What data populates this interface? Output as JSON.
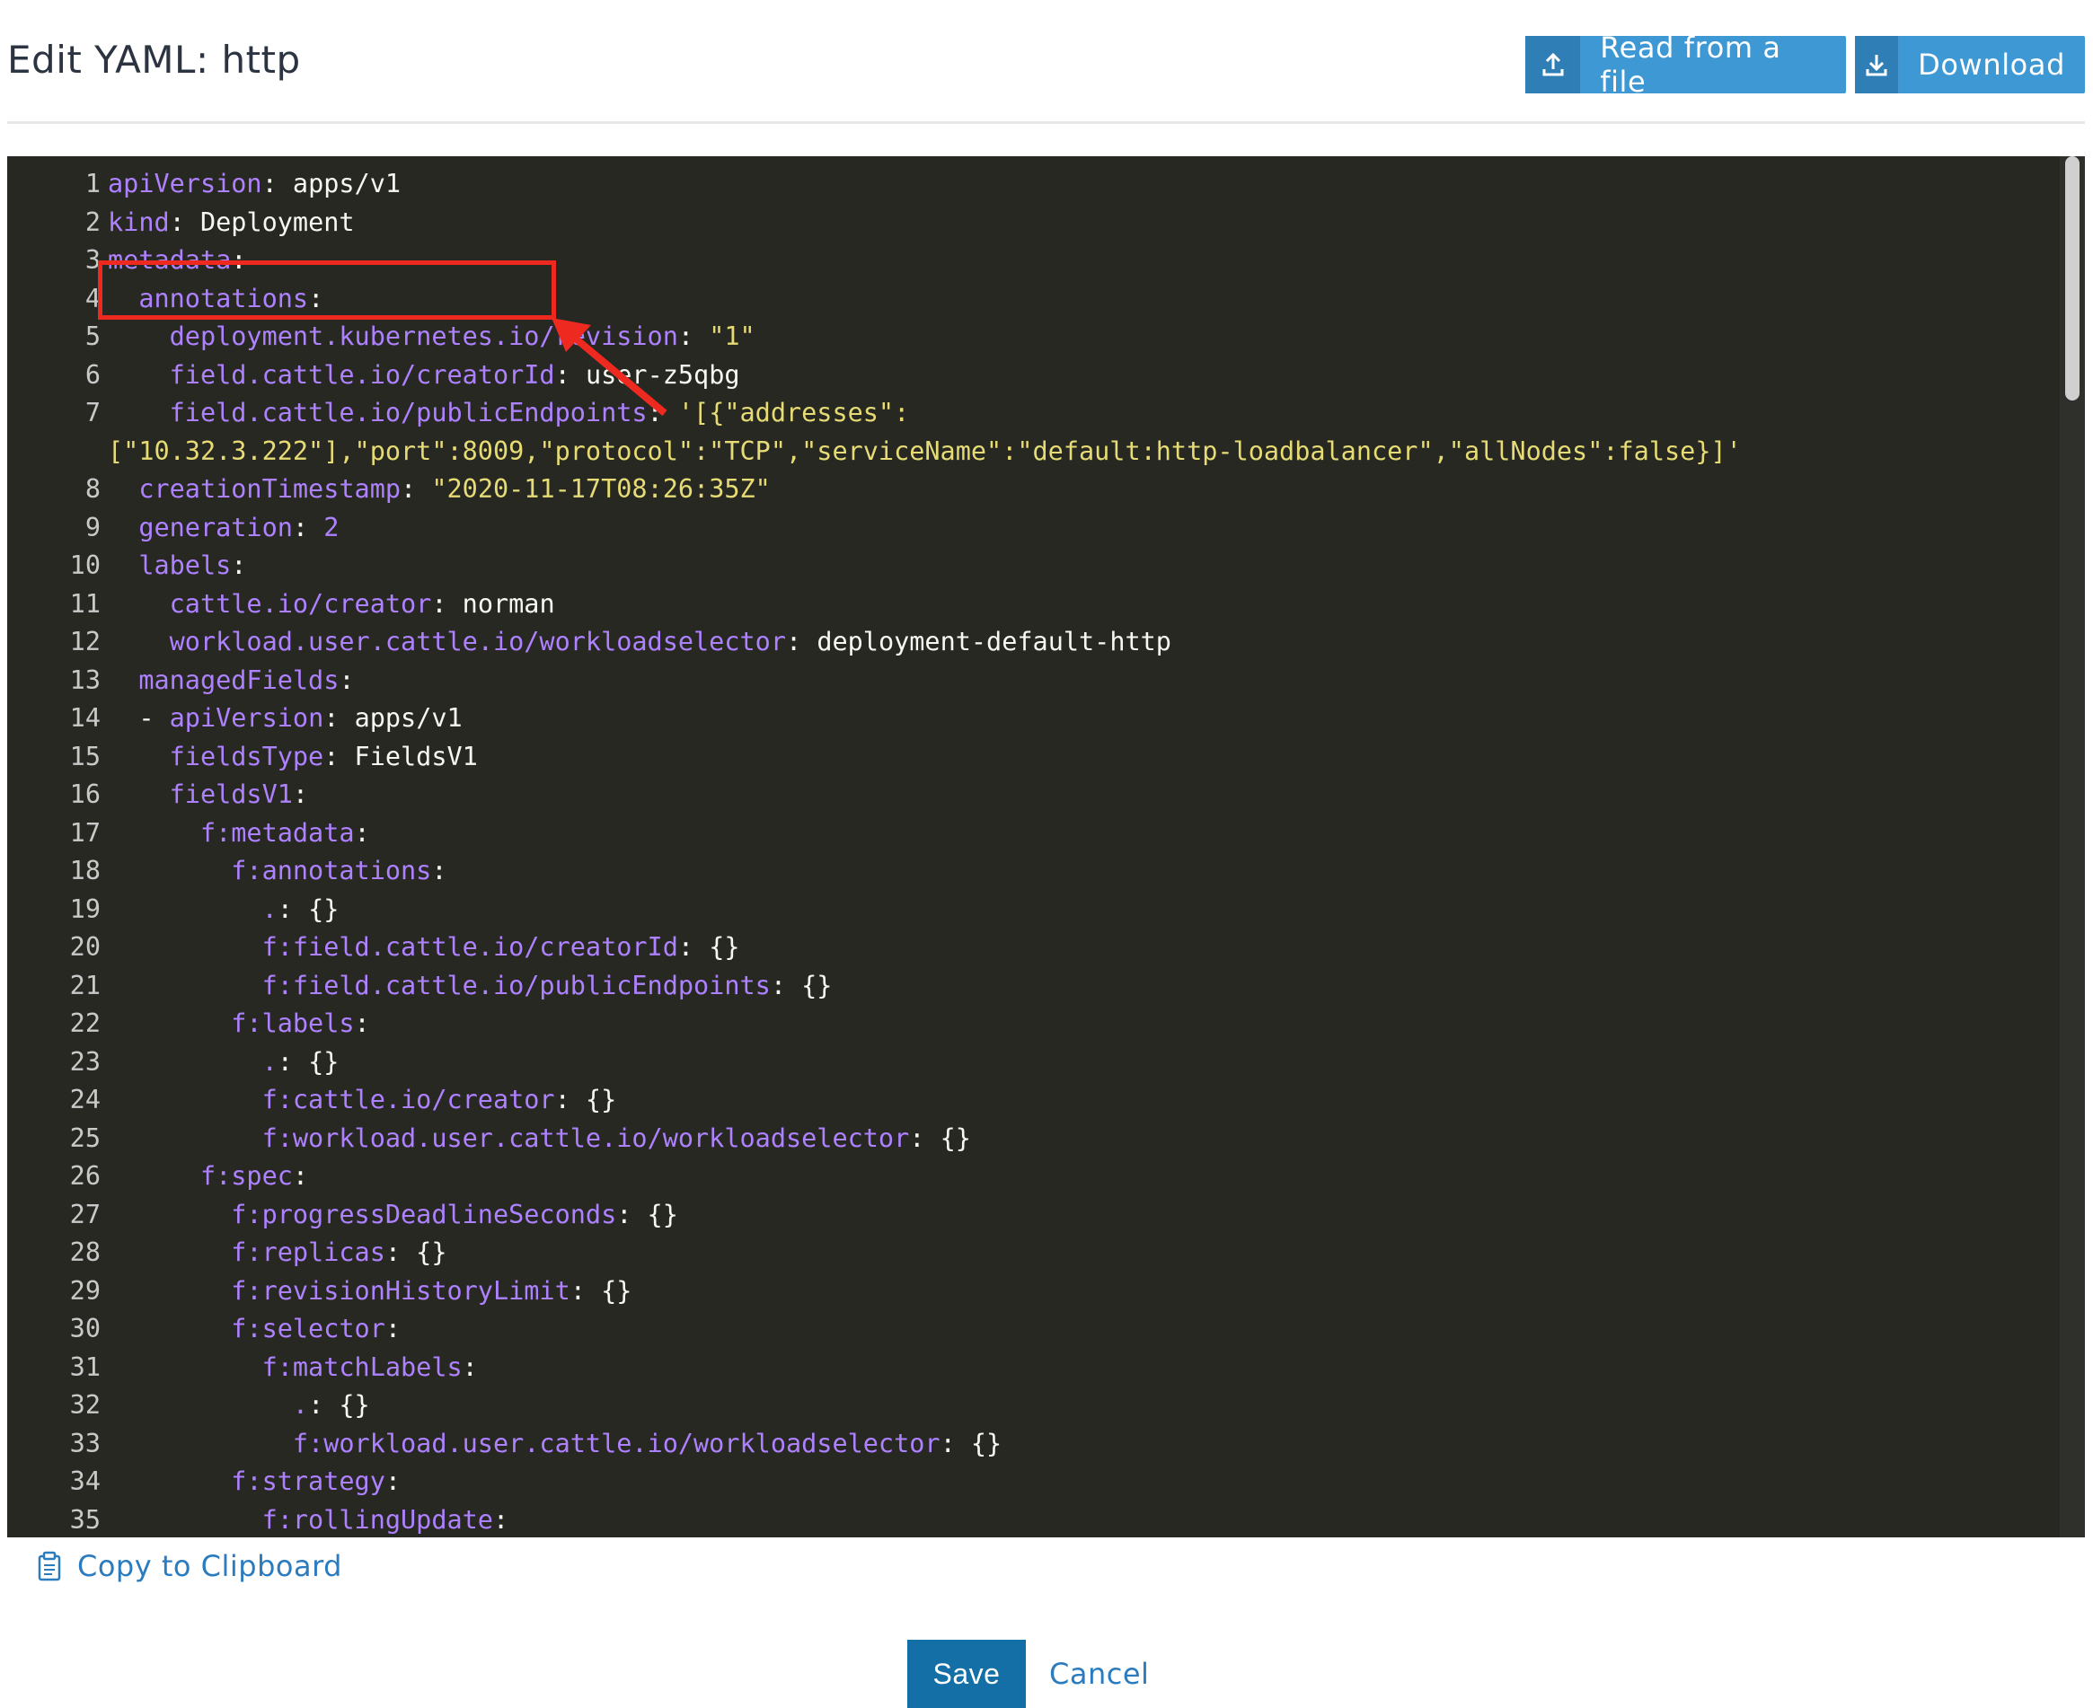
{
  "header": {
    "title": "Edit YAML: http",
    "read_file_label": "Read from a file",
    "download_label": "Download"
  },
  "editor": {
    "lines": [
      {
        "num": "1",
        "parts": [
          {
            "t": "apiVersion",
            "c": "k"
          },
          {
            "t": ": ",
            "c": "p"
          },
          {
            "t": "apps/v1",
            "c": "v"
          }
        ]
      },
      {
        "num": "2",
        "parts": [
          {
            "t": "kind",
            "c": "k"
          },
          {
            "t": ": ",
            "c": "p"
          },
          {
            "t": "Deployment",
            "c": "v"
          }
        ]
      },
      {
        "num": "3",
        "parts": [
          {
            "t": "metadata",
            "c": "k"
          },
          {
            "t": ":",
            "c": "p"
          }
        ]
      },
      {
        "num": "4",
        "parts": [
          {
            "t": "  annotations",
            "c": "k"
          },
          {
            "t": ":",
            "c": "p"
          }
        ]
      },
      {
        "num": "5",
        "parts": [
          {
            "t": "    deployment.kubernetes.io/revision",
            "c": "k"
          },
          {
            "t": ": ",
            "c": "p"
          },
          {
            "t": "\"1\"",
            "c": "s"
          }
        ]
      },
      {
        "num": "6",
        "parts": [
          {
            "t": "    field.cattle.io/creatorId",
            "c": "k"
          },
          {
            "t": ": ",
            "c": "p"
          },
          {
            "t": "user-z5qbg",
            "c": "v"
          }
        ]
      },
      {
        "num": "7",
        "parts": [
          {
            "t": "    field.cattle.io/publicEndpoints",
            "c": "k"
          },
          {
            "t": ": ",
            "c": "p"
          },
          {
            "t": "'[{\"addresses\":",
            "c": "s"
          }
        ]
      },
      {
        "num": "",
        "parts": [
          {
            "t": "[\"10.32.3.222\"],\"port\":8009,\"protocol\":\"TCP\",\"serviceName\":\"default:http-loadbalancer\",\"allNodes\":false}]'",
            "c": "s"
          }
        ]
      },
      {
        "num": "8",
        "parts": [
          {
            "t": "  creationTimestamp",
            "c": "k"
          },
          {
            "t": ": ",
            "c": "p"
          },
          {
            "t": "\"2020-11-17T08:26:35Z\"",
            "c": "s"
          }
        ]
      },
      {
        "num": "9",
        "parts": [
          {
            "t": "  generation",
            "c": "k"
          },
          {
            "t": ": ",
            "c": "p"
          },
          {
            "t": "2",
            "c": "n"
          }
        ]
      },
      {
        "num": "10",
        "parts": [
          {
            "t": "  labels",
            "c": "k"
          },
          {
            "t": ":",
            "c": "p"
          }
        ]
      },
      {
        "num": "11",
        "parts": [
          {
            "t": "    cattle.io/creator",
            "c": "k"
          },
          {
            "t": ": ",
            "c": "p"
          },
          {
            "t": "norman",
            "c": "v"
          }
        ]
      },
      {
        "num": "12",
        "parts": [
          {
            "t": "    workload.user.cattle.io/workloadselector",
            "c": "k"
          },
          {
            "t": ": ",
            "c": "p"
          },
          {
            "t": "deployment-default-http",
            "c": "v"
          }
        ]
      },
      {
        "num": "13",
        "parts": [
          {
            "t": "  managedFields",
            "c": "k"
          },
          {
            "t": ":",
            "c": "p"
          }
        ]
      },
      {
        "num": "14",
        "parts": [
          {
            "t": "  - ",
            "c": "p"
          },
          {
            "t": "apiVersion",
            "c": "k"
          },
          {
            "t": ": ",
            "c": "p"
          },
          {
            "t": "apps/v1",
            "c": "v"
          }
        ]
      },
      {
        "num": "15",
        "parts": [
          {
            "t": "    fieldsType",
            "c": "k"
          },
          {
            "t": ": ",
            "c": "p"
          },
          {
            "t": "FieldsV1",
            "c": "v"
          }
        ]
      },
      {
        "num": "16",
        "parts": [
          {
            "t": "    fieldsV1",
            "c": "k"
          },
          {
            "t": ":",
            "c": "p"
          }
        ]
      },
      {
        "num": "17",
        "parts": [
          {
            "t": "      f:metadata",
            "c": "k"
          },
          {
            "t": ":",
            "c": "p"
          }
        ]
      },
      {
        "num": "18",
        "parts": [
          {
            "t": "        f:annotations",
            "c": "k"
          },
          {
            "t": ":",
            "c": "p"
          }
        ]
      },
      {
        "num": "19",
        "parts": [
          {
            "t": "          .",
            "c": "k"
          },
          {
            "t": ": {}",
            "c": "p"
          }
        ]
      },
      {
        "num": "20",
        "parts": [
          {
            "t": "          f:field.cattle.io/creatorId",
            "c": "k"
          },
          {
            "t": ": {}",
            "c": "p"
          }
        ]
      },
      {
        "num": "21",
        "parts": [
          {
            "t": "          f:field.cattle.io/publicEndpoints",
            "c": "k"
          },
          {
            "t": ": {}",
            "c": "p"
          }
        ]
      },
      {
        "num": "22",
        "parts": [
          {
            "t": "        f:labels",
            "c": "k"
          },
          {
            "t": ":",
            "c": "p"
          }
        ]
      },
      {
        "num": "23",
        "parts": [
          {
            "t": "          .",
            "c": "k"
          },
          {
            "t": ": {}",
            "c": "p"
          }
        ]
      },
      {
        "num": "24",
        "parts": [
          {
            "t": "          f:cattle.io/creator",
            "c": "k"
          },
          {
            "t": ": {}",
            "c": "p"
          }
        ]
      },
      {
        "num": "25",
        "parts": [
          {
            "t": "          f:workload.user.cattle.io/workloadselector",
            "c": "k"
          },
          {
            "t": ": {}",
            "c": "p"
          }
        ]
      },
      {
        "num": "26",
        "parts": [
          {
            "t": "      f:spec",
            "c": "k"
          },
          {
            "t": ":",
            "c": "p"
          }
        ]
      },
      {
        "num": "27",
        "parts": [
          {
            "t": "        f:progressDeadlineSeconds",
            "c": "k"
          },
          {
            "t": ": {}",
            "c": "p"
          }
        ]
      },
      {
        "num": "28",
        "parts": [
          {
            "t": "        f:replicas",
            "c": "k"
          },
          {
            "t": ": {}",
            "c": "p"
          }
        ]
      },
      {
        "num": "29",
        "parts": [
          {
            "t": "        f:revisionHistoryLimit",
            "c": "k"
          },
          {
            "t": ": {}",
            "c": "p"
          }
        ]
      },
      {
        "num": "30",
        "parts": [
          {
            "t": "        f:selector",
            "c": "k"
          },
          {
            "t": ":",
            "c": "p"
          }
        ]
      },
      {
        "num": "31",
        "parts": [
          {
            "t": "          f:matchLabels",
            "c": "k"
          },
          {
            "t": ":",
            "c": "p"
          }
        ]
      },
      {
        "num": "32",
        "parts": [
          {
            "t": "            .",
            "c": "k"
          },
          {
            "t": ": {}",
            "c": "p"
          }
        ]
      },
      {
        "num": "33",
        "parts": [
          {
            "t": "            f:workload.user.cattle.io/workloadselector",
            "c": "k"
          },
          {
            "t": ": {}",
            "c": "p"
          }
        ]
      },
      {
        "num": "34",
        "parts": [
          {
            "t": "        f:strategy",
            "c": "k"
          },
          {
            "t": ":",
            "c": "p"
          }
        ]
      },
      {
        "num": "35",
        "parts": [
          {
            "t": "          f:rollingUpdate",
            "c": "k"
          },
          {
            "t": ":",
            "c": "p"
          }
        ]
      }
    ]
  },
  "footer": {
    "copy_label": "Copy to Clipboard",
    "save_label": "Save",
    "cancel_label": "Cancel"
  },
  "colors": {
    "accent": "#3d98d3",
    "primary_button": "#146fa6",
    "link": "#2b7bbf",
    "editor_bg": "#272822",
    "annotation_red": "#ee2a20"
  },
  "icons": {
    "read_file": "upload-icon",
    "download": "download-icon",
    "copy": "clipboard-icon"
  }
}
